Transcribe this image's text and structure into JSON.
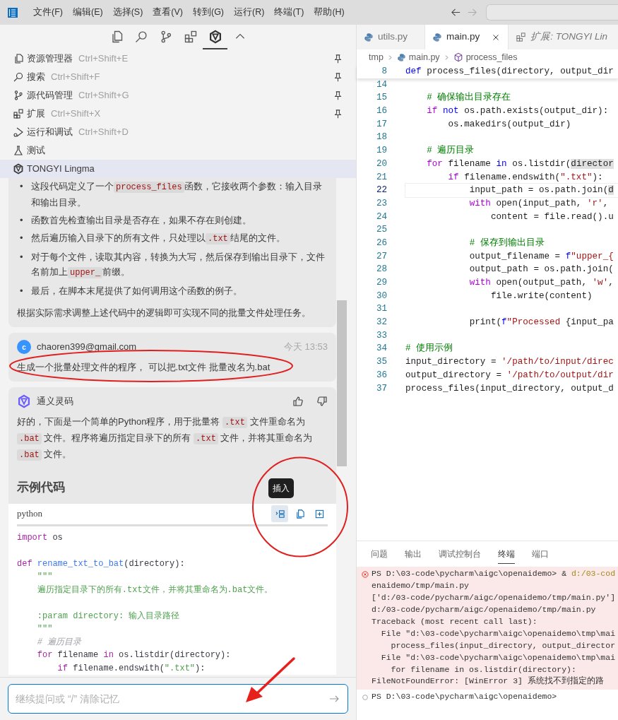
{
  "menu_bar": {
    "items": [
      "文件(F)",
      "编辑(E)",
      "选择(S)",
      "查看(V)",
      "转到(G)",
      "运行(R)",
      "终端(T)",
      "帮助(H)"
    ]
  },
  "activity_bar": [
    {
      "selected": false
    },
    {
      "selected": false
    },
    {
      "selected": false
    },
    {
      "selected": false
    },
    {
      "selected": true
    }
  ],
  "views": [
    {
      "label": "资源管理器",
      "shortcut": "Ctrl+Shift+E",
      "pinned": true,
      "selected": false
    },
    {
      "label": "搜索",
      "shortcut": "Ctrl+Shift+F",
      "pinned": true,
      "selected": false
    },
    {
      "label": "源代码管理",
      "shortcut": "Ctrl+Shift+G",
      "pinned": true,
      "selected": false
    },
    {
      "label": "扩展",
      "shortcut": "Ctrl+Shift+X",
      "pinned": true,
      "selected": false
    },
    {
      "label": "运行和调试",
      "shortcut": "Ctrl+Shift+D",
      "pinned": false,
      "selected": false
    },
    {
      "label": "测试",
      "pinned": false,
      "selected": false
    },
    {
      "label": "TONGYI Lingma",
      "pinned": false,
      "selected": true
    }
  ],
  "chat": {
    "messages": [
      {
        "kind": "answer_tail",
        "bullets": [
          {
            "marker": "•",
            "segments": [
              {
                "text": "这段代码定义了一个"
              },
              {
                "text": "process_files",
                "kind": "code"
              },
              {
                "text": "函数，它接收两个参数：输入目录和输出目录。"
              }
            ]
          },
          {
            "marker": "•",
            "segments": [
              {
                "text": "函数首先检查输出目录是否存在，如果不存在则创建。"
              }
            ]
          },
          {
            "marker": "•",
            "segments": [
              {
                "text": "然后遍历输入目录下的所有文件，只处理以"
              },
              {
                "text": ".txt",
                "kind": "code"
              },
              {
                "text": "结尾的文件。"
              }
            ]
          },
          {
            "marker": "•",
            "segments": [
              {
                "text": "对于每个文件，读取其内容，转换为大写，然后保存到输出目录下，文件名前加上"
              },
              {
                "text": "upper_",
                "kind": "code"
              },
              {
                "text": "前缀。"
              }
            ]
          },
          {
            "marker": "•",
            "segments": [
              {
                "text": "最后，在脚本末尾提供了如何调用这个函数的例子。"
              }
            ]
          }
        ],
        "closing": "根据实际需求调整上述代码中的逻辑即可实现不同的批量文件处理任务。"
      },
      {
        "kind": "user",
        "avatar": "c",
        "author": "chaoren399@gmail.com",
        "time": "今天 13:53",
        "text": "生成一个批量处理文件的程序， 可以把.txt文件 批量改名为.bat"
      },
      {
        "kind": "answer",
        "author": "通义灵码",
        "paragraph": [
          {
            "text": "好的，下面是一个简单的Python程序，用于批量将 "
          },
          {
            "text": ".txt",
            "kind": "code"
          },
          {
            "text": " 文件重命名为 "
          },
          {
            "text": ".bat",
            "kind": "code"
          },
          {
            "text": " 文件。程序将遍历指定目录下的所有 "
          },
          {
            "text": ".txt",
            "kind": "code"
          },
          {
            "text": " 文件，并将其重命名为 "
          },
          {
            "text": ".bat",
            "kind": "code"
          },
          {
            "text": " 文件。"
          }
        ],
        "heading": "示例代码",
        "code": {
          "language": "python",
          "tooltip": "插入",
          "tools": [
            {
              "active": true
            },
            {
              "active": false
            },
            {
              "active": false
            }
          ],
          "lines": [
            {
              "kind": "code",
              "segments": [
                {
                  "text": "import",
                  "kind": "keyword"
                },
                {
                  "text": " os"
                }
              ]
            },
            {
              "kind": "blank"
            },
            {
              "kind": "code",
              "segments": [
                {
                  "text": "def",
                  "kind": "keyword"
                },
                {
                  "text": " rename_txt_to_bat",
                  "kind": "function"
                },
                {
                  "text": "(directory):"
                }
              ]
            },
            {
              "kind": "code",
              "segments": [
                {
                  "text": "    \"\"\"",
                  "kind": "string"
                }
              ]
            },
            {
              "kind": "code",
              "segments": [
                {
                  "text": "    遍历指定目录下的所有.txt文件，并将其重命名为.bat文件。",
                  "kind": "string"
                }
              ]
            },
            {
              "kind": "blank"
            },
            {
              "kind": "code",
              "segments": [
                {
                  "text": "    :param directory: 输入目录路径",
                  "kind": "string"
                }
              ]
            },
            {
              "kind": "code",
              "segments": [
                {
                  "text": "    \"\"\"",
                  "kind": "string"
                }
              ]
            },
            {
              "kind": "code",
              "segments": [
                {
                  "text": "    # 遍历目录",
                  "kind": "comment"
                }
              ]
            },
            {
              "kind": "code",
              "segments": [
                {
                  "text": "    for",
                  "kind": "keyword"
                },
                {
                  "text": " filename"
                },
                {
                  "text": " in",
                  "kind": "keyword"
                },
                {
                  "text": " os.listdir(directory):"
                }
              ]
            },
            {
              "kind": "code",
              "segments": [
                {
                  "text": "        if",
                  "kind": "keyword"
                },
                {
                  "text": " filename.endswith("
                },
                {
                  "text": "\".txt\"",
                  "kind": "string"
                },
                {
                  "text": "):"
                }
              ]
            }
          ]
        }
      }
    ],
    "input": {
      "placeholder": "继续提问或 “/” 清除记忆"
    }
  },
  "editor": {
    "tabs": [
      {
        "label": "utils.py",
        "kind": "file",
        "selected": false
      },
      {
        "label": "main.py",
        "kind": "file",
        "selected": true
      },
      {
        "label": "扩展: TONGYI Lin",
        "kind": "extension",
        "selected": false
      }
    ],
    "breadcrumb": [
      "tmp",
      "main.py",
      "process_files"
    ],
    "sticky": {
      "number": "8",
      "segments": [
        {
          "text": "def",
          "kind": "keyword"
        },
        {
          "text": " process_files(directory, output_dir"
        }
      ]
    },
    "lines": [
      {
        "number": "14",
        "current": false
      },
      {
        "number": "15",
        "current": false,
        "segments": [
          {
            "text": "    # 确保输出目录存在",
            "kind": "comment"
          }
        ]
      },
      {
        "number": "16",
        "current": false,
        "segments": [
          {
            "text": "    if",
            "kind": "control"
          },
          {
            "text": " not",
            "kind": "keyword"
          },
          {
            "text": " os.path.exists(output_dir):"
          }
        ]
      },
      {
        "number": "17",
        "current": false,
        "segments": [
          {
            "text": "        os.makedirs(output_dir)"
          }
        ]
      },
      {
        "number": "18",
        "current": false
      },
      {
        "number": "19",
        "current": false,
        "segments": [
          {
            "text": "    # 遍历目录",
            "kind": "comment"
          }
        ]
      },
      {
        "number": "20",
        "current": false,
        "segments": [
          {
            "text": "    for",
            "kind": "control"
          },
          {
            "text": " filename"
          },
          {
            "text": " in",
            "kind": "keyword"
          },
          {
            "text": " os.listdir("
          },
          {
            "text": "director",
            "kind": "selection"
          }
        ]
      },
      {
        "number": "21",
        "current": false,
        "segments": [
          {
            "text": "        if",
            "kind": "control"
          },
          {
            "text": " filename.endswith("
          },
          {
            "text": "\".txt\"",
            "kind": "string"
          },
          {
            "text": "):"
          }
        ]
      },
      {
        "number": "22",
        "current": true,
        "segments": [
          {
            "text": "            input_path = os.path.join("
          },
          {
            "text": "d",
            "kind": "selection"
          }
        ]
      },
      {
        "number": "23",
        "current": false,
        "segments": [
          {
            "text": "            with",
            "kind": "control"
          },
          {
            "text": " open(input_path, "
          },
          {
            "text": "'r'",
            "kind": "string"
          },
          {
            "text": ","
          }
        ]
      },
      {
        "number": "24",
        "current": false,
        "segments": [
          {
            "text": "                content = file.read().u"
          }
        ]
      },
      {
        "number": "25",
        "current": false
      },
      {
        "number": "26",
        "current": false,
        "segments": [
          {
            "text": "            # 保存到输出目录",
            "kind": "comment"
          }
        ]
      },
      {
        "number": "27",
        "current": false,
        "segments": [
          {
            "text": "            output_filename = "
          },
          {
            "text": "f",
            "kind": "keyword"
          },
          {
            "text": "\"upper_{",
            "kind": "string"
          }
        ]
      },
      {
        "number": "28",
        "current": false,
        "segments": [
          {
            "text": "            output_path = os.path.join("
          }
        ]
      },
      {
        "number": "29",
        "current": false,
        "segments": [
          {
            "text": "            with",
            "kind": "control"
          },
          {
            "text": " open(output_path, "
          },
          {
            "text": "'w'",
            "kind": "string"
          },
          {
            "text": ","
          }
        ]
      },
      {
        "number": "30",
        "current": false,
        "segments": [
          {
            "text": "                file.write(content)"
          }
        ]
      },
      {
        "number": "31",
        "current": false
      },
      {
        "number": "32",
        "current": false,
        "segments": [
          {
            "text": "            print("
          },
          {
            "text": "f",
            "kind": "keyword"
          },
          {
            "text": "\"Processed ",
            "kind": "string"
          },
          {
            "text": "{input_pa"
          }
        ]
      },
      {
        "number": "33",
        "current": false
      },
      {
        "number": "34",
        "current": false,
        "segments": [
          {
            "text": "# 使用示例",
            "kind": "comment"
          }
        ]
      },
      {
        "number": "35",
        "current": false,
        "segments": [
          {
            "text": "input_directory = "
          },
          {
            "text": "'/path/to/input/direc",
            "kind": "string"
          }
        ]
      },
      {
        "number": "36",
        "current": false,
        "segments": [
          {
            "text": "output_directory = "
          },
          {
            "text": "'/path/to/output/dir",
            "kind": "string"
          }
        ]
      },
      {
        "number": "37",
        "current": false,
        "segments": [
          {
            "text": "process_files(input_directory, output_d"
          }
        ]
      }
    ]
  },
  "panel": {
    "tabs": [
      {
        "label": "问题",
        "selected": false
      },
      {
        "label": "输出",
        "selected": false
      },
      {
        "label": "调试控制台",
        "selected": false
      },
      {
        "label": "终端",
        "selected": true
      },
      {
        "label": "端口",
        "selected": false
      }
    ],
    "terminal": [
      {
        "kind": "error",
        "lines": [
          {
            "text": "PS D:\\03-code\\pycharm\\aigc\\openaidemo> & ",
            "path": "d:/03-cod"
          },
          {
            "text": "enaidemo/tmp/main.py"
          },
          {
            "text": "['d:/03-code/pycharm/aigc/openaidemo/tmp/main.py']"
          },
          {
            "text": "d:/03-code/pycharm/aigc/openaidemo/tmp/main.py"
          },
          {
            "text": "Traceback (most recent call last):"
          },
          {
            "text": "  File \"d:\\03-code\\pycharm\\aigc\\openaidemo\\tmp\\mai"
          },
          {
            "text": "    process_files(input_directory, output_director"
          },
          {
            "text": "  File \"d:\\03-code\\pycharm\\aigc\\openaidemo\\tmp\\mai"
          },
          {
            "text": "    for filename in os.listdir(directory):"
          },
          {
            "text": "FileNotFoundError: [WinError 3] 系统找不到指定的路"
          }
        ]
      },
      {
        "kind": "idle",
        "lines": [
          {
            "text": "PS D:\\03-code\\pycharm\\aigc\\openaidemo>"
          }
        ]
      }
    ]
  },
  "annotations": [
    {
      "kind": "ellipse"
    },
    {
      "kind": "circle"
    },
    {
      "kind": "arrow"
    }
  ]
}
